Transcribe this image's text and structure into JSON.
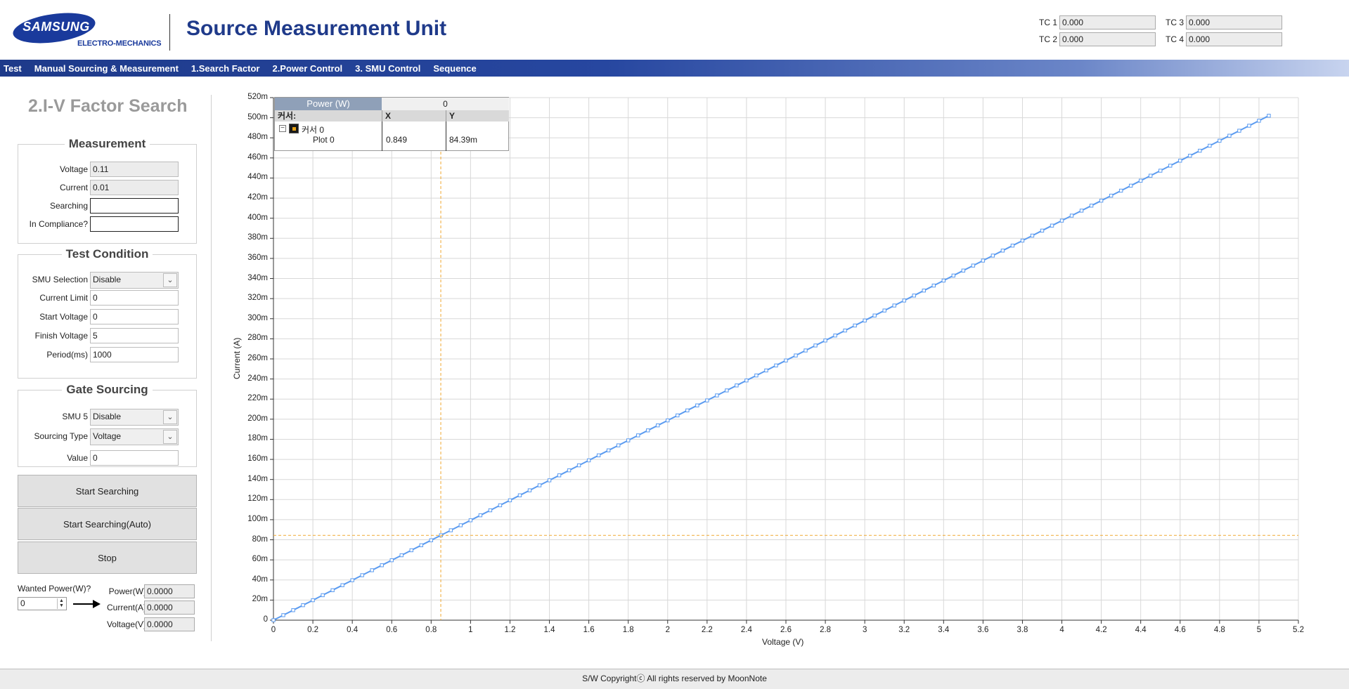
{
  "header": {
    "logo_text": "SAMSUNG",
    "logo_sub": "ELECTRO-MECHANICS",
    "title": "Source Measurement Unit",
    "tc": [
      {
        "label": "TC 1",
        "value": "0.000"
      },
      {
        "label": "TC 2",
        "value": "0.000"
      },
      {
        "label": "TC 3",
        "value": "0.000"
      },
      {
        "label": "TC 4",
        "value": "0.000"
      }
    ]
  },
  "menu": [
    "Test",
    "Manual Sourcing & Measurement",
    "1.Search Factor",
    "2.Power Control",
    "3. SMU Control",
    "Sequence"
  ],
  "panel": {
    "title": "2.I-V Factor Search",
    "measurement": {
      "title": "Measurement",
      "voltage_label": "Voltage",
      "voltage": "0.11",
      "current_label": "Current",
      "current": "0.01",
      "searching_label": "Searching",
      "searching": "",
      "compliance_label": "In Compliance?",
      "compliance": ""
    },
    "test_condition": {
      "title": "Test Condition",
      "smu_label": "SMU Selection",
      "smu": "Disable",
      "current_limit_label": "Current Limit",
      "current_limit": "0",
      "start_voltage_label": "Start Voltage",
      "start_voltage": "0",
      "finish_voltage_label": "Finish Voltage",
      "finish_voltage": "5",
      "period_label": "Period(ms)",
      "period": "1000"
    },
    "gate_sourcing": {
      "title": "Gate Sourcing",
      "smu5_label": "SMU 5",
      "smu5": "Disable",
      "type_label": "Sourcing Type",
      "type": "Voltage",
      "value_label": "Value",
      "value": "0"
    },
    "buttons": {
      "start": "Start Searching",
      "start_auto": "Start Searching(Auto)",
      "stop": "Stop"
    },
    "wanted_power": {
      "label": "Wanted Power(W)?",
      "value": "0",
      "power_label": "Power(W)",
      "power": "0.0000",
      "current_label": "Current(A)",
      "current": "0.0000",
      "voltage_label": "Voltage(V)",
      "voltage": "0.0000"
    }
  },
  "cursor_legend": {
    "header_label": "Power (W)",
    "header_value": "0",
    "col_name": "커서:",
    "col_x": "X",
    "col_y": "Y",
    "cursor_name": "커서 0",
    "plot_name": "Plot 0",
    "x": "0.849",
    "y": "84.39m"
  },
  "chart_data": {
    "type": "line",
    "xlabel": "Voltage (V)",
    "ylabel": "Current (A)",
    "xlim": [
      0,
      5.2
    ],
    "ylim": [
      0,
      0.52
    ],
    "x_ticks": [
      "0",
      "0.2",
      "0.4",
      "0.6",
      "0.8",
      "1",
      "1.2",
      "1.4",
      "1.6",
      "1.8",
      "2",
      "2.2",
      "2.4",
      "2.6",
      "2.8",
      "3",
      "3.2",
      "3.4",
      "3.6",
      "3.8",
      "4",
      "4.2",
      "4.4",
      "4.6",
      "4.8",
      "5",
      "5.2"
    ],
    "y_ticks": [
      "0",
      "20m",
      "40m",
      "60m",
      "80m",
      "100m",
      "120m",
      "140m",
      "160m",
      "180m",
      "200m",
      "220m",
      "240m",
      "260m",
      "280m",
      "300m",
      "320m",
      "340m",
      "360m",
      "380m",
      "400m",
      "420m",
      "440m",
      "460m",
      "480m",
      "500m",
      "520m"
    ],
    "grid": true,
    "series": [
      {
        "color": "#5b9bf0",
        "x_start": 0,
        "x_end": 5.05,
        "x_step": 0.05,
        "slope": 0.0994
      }
    ],
    "cursor": {
      "x": 0.849,
      "y": 0.08439,
      "color": "#f0a830"
    }
  },
  "footer": "S/W Copyrightⓒ All rights reserved by MoonNote"
}
